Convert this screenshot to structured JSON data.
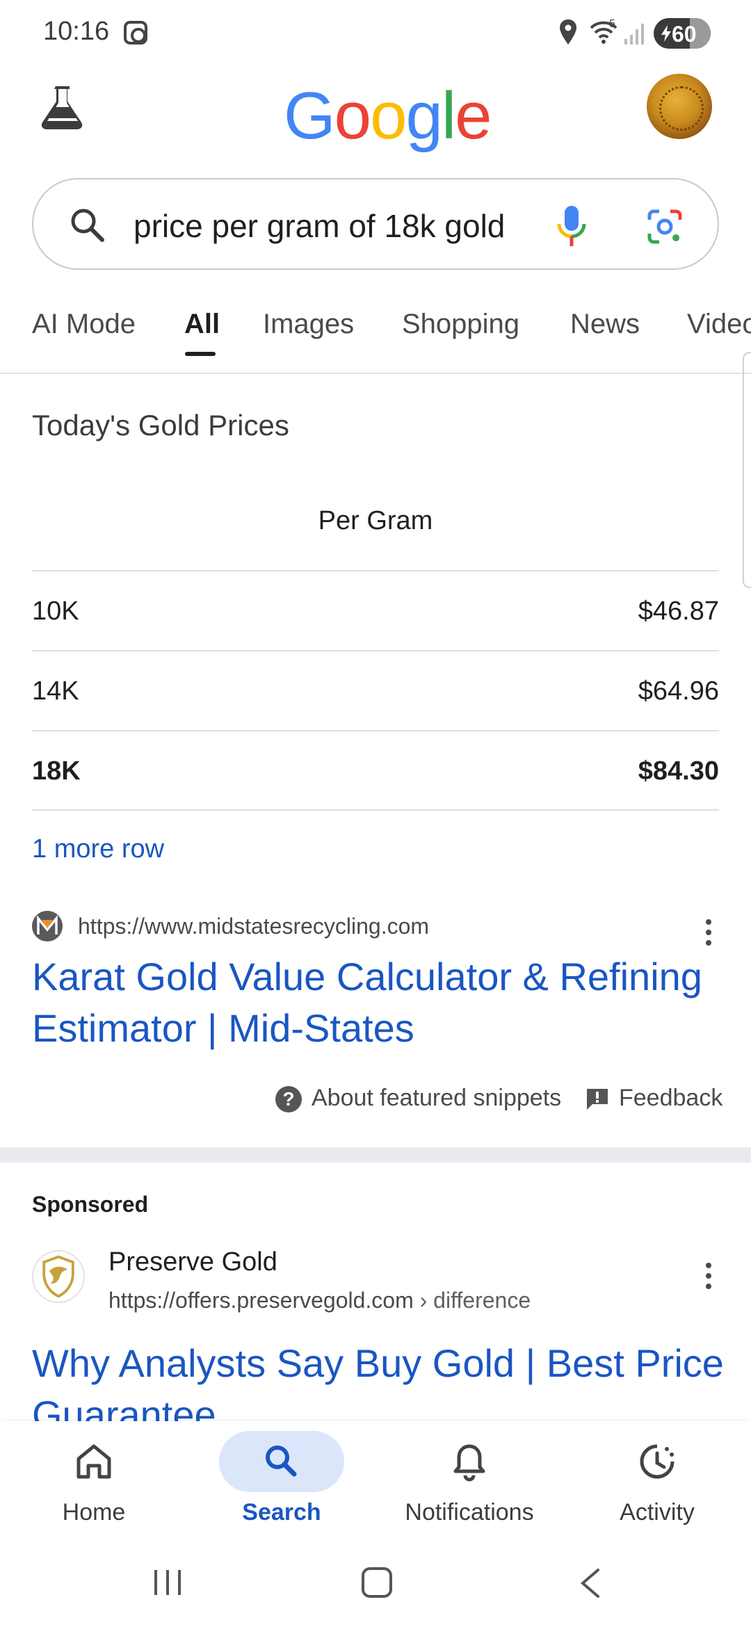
{
  "status_bar": {
    "time": "10:16",
    "battery": "60",
    "wifi_badge": "5"
  },
  "header": {
    "logo_letters": [
      "G",
      "o",
      "o",
      "g",
      "l",
      "e"
    ],
    "logo_colors": [
      "#4285F4",
      "#EA4335",
      "#FBBC05",
      "#4285F4",
      "#34A853",
      "#EA4335"
    ]
  },
  "search": {
    "query": "price per gram of 18k gold"
  },
  "tabs": [
    {
      "label": "AI Mode"
    },
    {
      "label": "All",
      "active": true
    },
    {
      "label": "Images"
    },
    {
      "label": "Shopping"
    },
    {
      "label": "News"
    },
    {
      "label": "Videos"
    }
  ],
  "gold_prices": {
    "title": "Today's Gold Prices",
    "column_header": "Per Gram",
    "rows": [
      {
        "karat": "10K",
        "price": "$46.87"
      },
      {
        "karat": "14K",
        "price": "$64.96"
      },
      {
        "karat": "18K",
        "price": "$84.30",
        "highlighted": true
      }
    ],
    "more_rows": "1 more row"
  },
  "result": {
    "url": "https://www.midstatesrecycling.com",
    "title": "Karat Gold Value Calculator & Refining Estimator | Mid-States",
    "about_snippets": "About featured snippets",
    "feedback": "Feedback"
  },
  "ad": {
    "label": "Sponsored",
    "advertiser": "Preserve Gold",
    "url": "https://offers.preservegold.com",
    "breadcrumb": " › difference",
    "title": "Why Analysts Say Buy Gold | Best Price Guarantee"
  },
  "bottom_nav": {
    "home": "Home",
    "search": "Search",
    "notifications": "Notifications",
    "activity": "Activity"
  },
  "colors": {
    "link_blue": "#1a56c2",
    "active_pill": "#dce6fb"
  }
}
